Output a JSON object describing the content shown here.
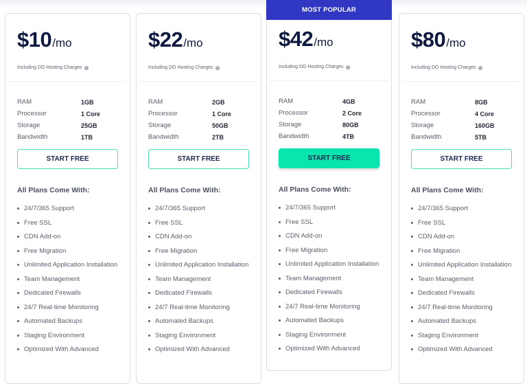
{
  "colors": {
    "badge_bg": "#2f37c3",
    "cta_accent": "#09e5ad",
    "cta_outline": "#4ce0b0",
    "price_text": "#0f1a40"
  },
  "plans": [
    {
      "price": "$10",
      "period": "/mo",
      "hint": "Including DO Hosting Charges",
      "specs": [
        {
          "label": "RAM",
          "value": "1GB"
        },
        {
          "label": "Processor",
          "value": "1 Core"
        },
        {
          "label": "Storage",
          "value": "25GB"
        },
        {
          "label": "Bandwidth",
          "value": "1TB"
        }
      ],
      "cta": "START FREE"
    },
    {
      "price": "$22",
      "period": "/mo",
      "hint": "Including DO Hosting Charges",
      "specs": [
        {
          "label": "RAM",
          "value": "2GB"
        },
        {
          "label": "Processor",
          "value": "1 Core"
        },
        {
          "label": "Storage",
          "value": "50GB"
        },
        {
          "label": "Bandwidth",
          "value": "2TB"
        }
      ],
      "cta": "START FREE"
    },
    {
      "badge": "MOST POPULAR",
      "price": "$42",
      "period": "/mo",
      "hint": "Including DO Hosting Charges",
      "specs": [
        {
          "label": "RAM",
          "value": "4GB"
        },
        {
          "label": "Processor",
          "value": "2 Core"
        },
        {
          "label": "Storage",
          "value": "80GB"
        },
        {
          "label": "Bandwidth",
          "value": "4TB"
        }
      ],
      "cta": "START FREE"
    },
    {
      "price": "$80",
      "period": "/mo",
      "hint": "Including DO Hosting Charges",
      "specs": [
        {
          "label": "RAM",
          "value": "8GB"
        },
        {
          "label": "Processor",
          "value": "4 Core"
        },
        {
          "label": "Storage",
          "value": "160GB"
        },
        {
          "label": "Bandwidth",
          "value": "5TB"
        }
      ],
      "cta": "START FREE"
    }
  ],
  "features_title": "All Plans Come With:",
  "features": [
    "24/7/365 Support",
    "Free SSL",
    "CDN Add-on",
    "Free Migration",
    "Unlimited Application Installation",
    "Team Management",
    "Dedicated Firewalls",
    "24/7 Real-time Monitoring",
    "Automated Backups",
    "Staging Environment",
    "Optimized With Advanced"
  ],
  "icons": {
    "hint_icon": "info-circle-icon",
    "bullet": "bullet-dot"
  }
}
